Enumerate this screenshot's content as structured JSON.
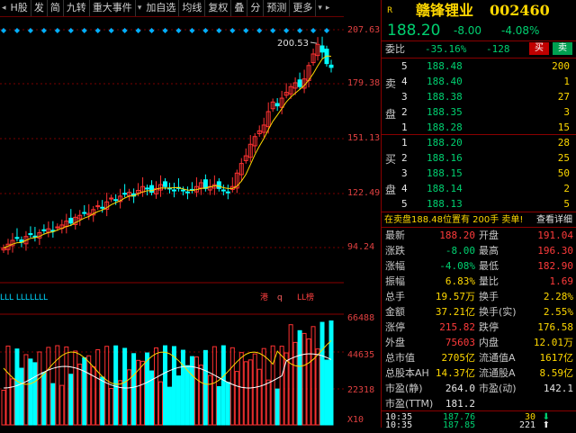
{
  "toolbar": {
    "items": [
      "H股",
      "发",
      "简",
      "九转",
      "重大事件",
      "加自选",
      "均线",
      "复权",
      "叠",
      "分",
      "预测",
      "更多"
    ],
    "arrow_down": "▾",
    "arrow_right": "▸"
  },
  "chart": {
    "price_axis": [
      "207.63",
      "179.38",
      "151.13",
      "122.49",
      "94.24"
    ],
    "volume_axis": [
      "66488",
      "44635",
      "22318",
      "X10"
    ],
    "high_label": "200.53",
    "markers_text": "LLL LLLLLLL",
    "markers_right": [
      "港",
      "q",
      "LL榜"
    ],
    "colors": {
      "up": "#ff3232",
      "down": "#00ffff",
      "ma": "#ffd800",
      "ma2": "#ffffff",
      "diamond": "#00b0ff"
    }
  },
  "panel": {
    "code_prefix": "R",
    "name": "赣锋锂业",
    "code": "002460",
    "price": "188.20",
    "change": "-8.00",
    "change_pct": "-4.08%",
    "weibi_label": "委比",
    "weibi_value": "-35.16%",
    "weicha_value": "-128",
    "buy_btn": "买",
    "sell_btn": "卖",
    "sell_side_label": [
      "卖",
      "盘"
    ],
    "buy_side_label": [
      "买",
      "盘"
    ],
    "sells": [
      {
        "level": "5",
        "price": "188.48",
        "vol": "200"
      },
      {
        "level": "4",
        "price": "188.40",
        "vol": "1"
      },
      {
        "level": "3",
        "price": "188.38",
        "vol": "27"
      },
      {
        "level": "2",
        "price": "188.35",
        "vol": "3"
      },
      {
        "level": "1",
        "price": "188.28",
        "vol": "15"
      }
    ],
    "buys": [
      {
        "level": "1",
        "price": "188.20",
        "vol": "28"
      },
      {
        "level": "2",
        "price": "188.16",
        "vol": "25"
      },
      {
        "level": "3",
        "price": "188.15",
        "vol": "50"
      },
      {
        "level": "4",
        "price": "188.14",
        "vol": "2"
      },
      {
        "level": "5",
        "price": "188.13",
        "vol": "5"
      }
    ],
    "notice": "在卖盘188.48位置有 200手 卖单!",
    "notice_link": "查看详细",
    "stats": [
      {
        "l1": "最新",
        "v1": "188.20",
        "c1": "red",
        "l2": "开盘",
        "v2": "191.04",
        "c2": "red"
      },
      {
        "l1": "涨跌",
        "v1": "-8.00",
        "c1": "green",
        "l2": "最高",
        "v2": "196.30",
        "c2": "red"
      },
      {
        "l1": "涨幅",
        "v1": "-4.08%",
        "c1": "green",
        "l2": "最低",
        "v2": "182.90",
        "c2": "red"
      },
      {
        "l1": "振幅",
        "v1": "6.83%",
        "c1": "yellow",
        "l2": "量比",
        "v2": "1.69",
        "c2": "red"
      },
      {
        "l1": "总手",
        "v1": "19.57万",
        "c1": "yellow",
        "l2": "换手",
        "v2": "2.28%",
        "c2": "yellow"
      },
      {
        "l1": "金额",
        "v1": "37.21亿",
        "c1": "yellow",
        "l2": "换手(实)",
        "v2": "2.55%",
        "c2": "yellow"
      },
      {
        "l1": "涨停",
        "v1": "215.82",
        "c1": "red",
        "l2": "跌停",
        "v2": "176.58",
        "c2": "yellow"
      },
      {
        "l1": "外盘",
        "v1": "75603",
        "c1": "red",
        "l2": "内盘",
        "v2": "12.01万",
        "c2": "yellow"
      },
      {
        "l1": "总市值",
        "v1": "2705亿",
        "c1": "yellow",
        "l2": "流通值A",
        "v2": "1617亿",
        "c2": "yellow"
      },
      {
        "l1": "总股本AH",
        "v1": "14.37亿",
        "c1": "yellow",
        "l2": "流通股A",
        "v2": "8.59亿",
        "c2": "yellow"
      },
      {
        "l1": "市盈(静)",
        "v1": "264.0",
        "c1": "white",
        "l2": "市盈(动)",
        "v2": "142.1",
        "c2": "white"
      },
      {
        "l1": "市盈(TTM)",
        "v1": "181.2",
        "c1": "white",
        "l2": "",
        "v2": "",
        "c2": "white"
      }
    ],
    "ticks": [
      {
        "time": "10:35",
        "price": "187.76",
        "vol": "30",
        "dir": "down"
      },
      {
        "time": "10:35",
        "price": "187.85",
        "vol": "221",
        "dir": "up"
      }
    ]
  }
}
